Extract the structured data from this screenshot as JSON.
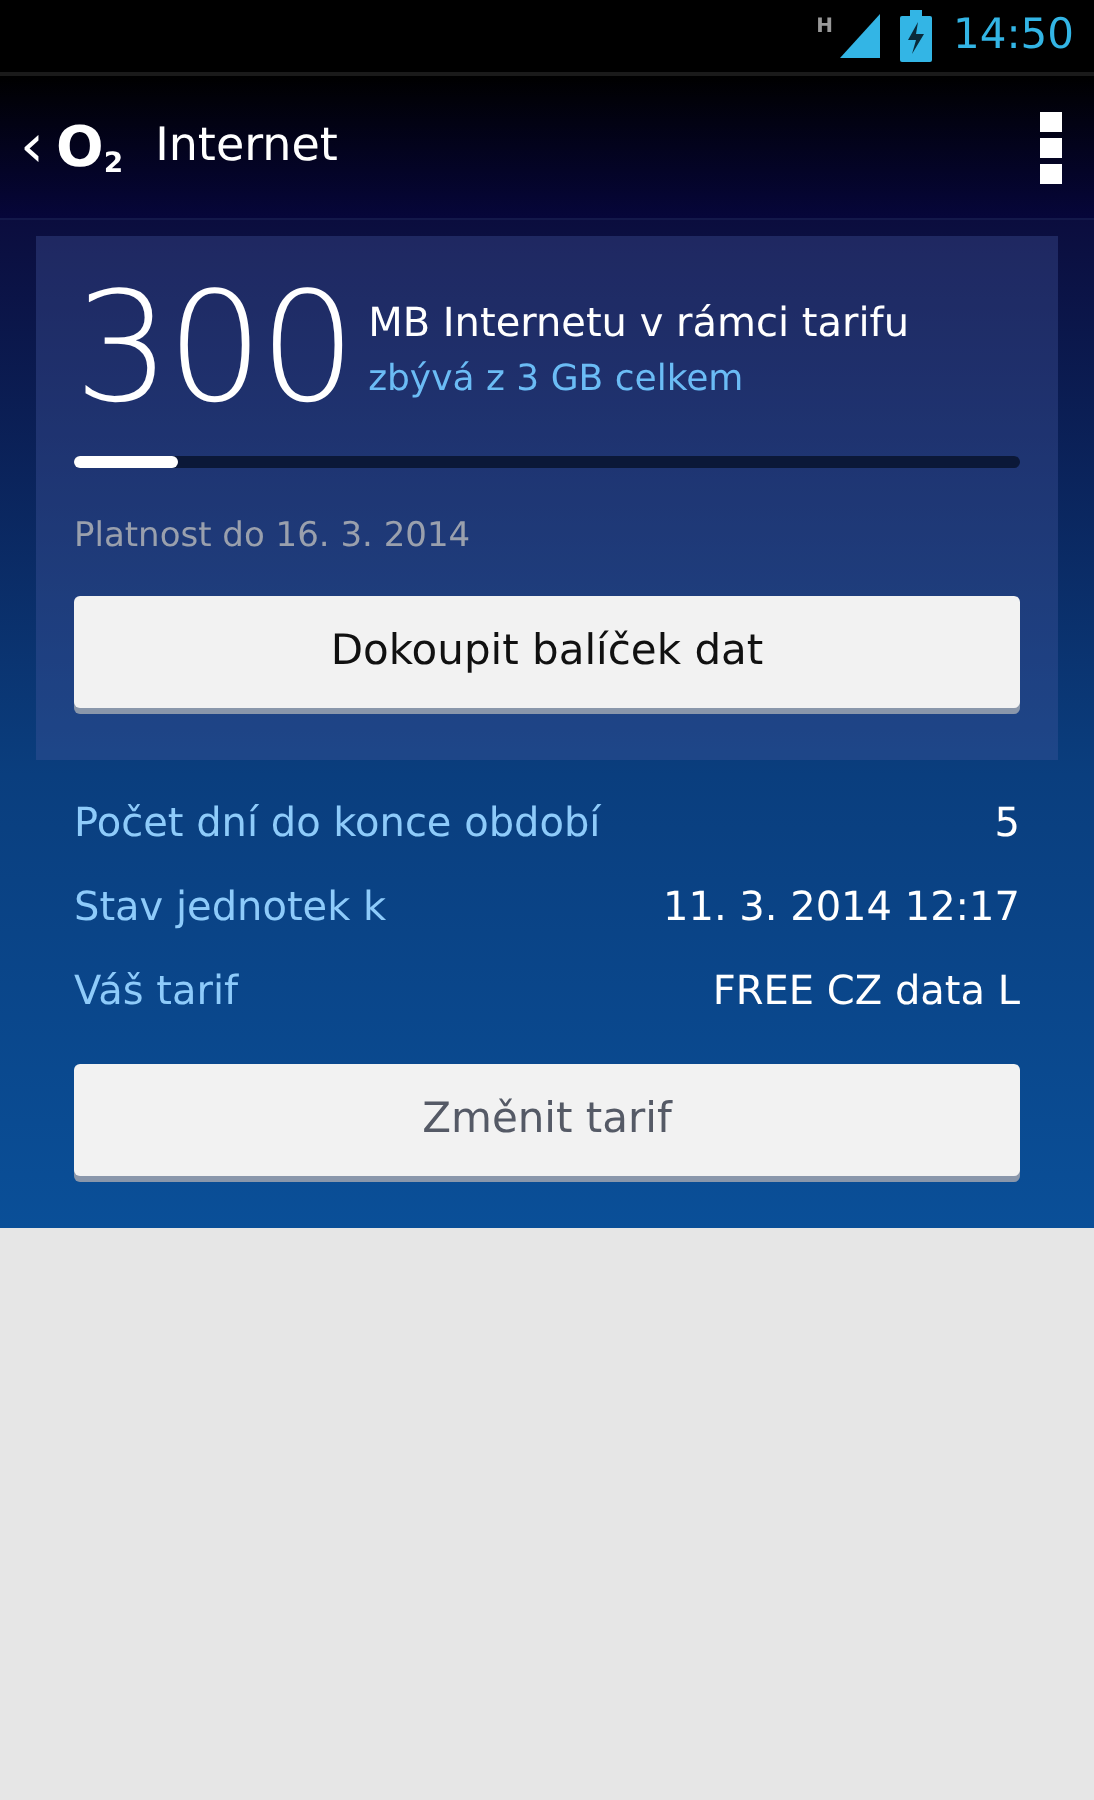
{
  "status_bar": {
    "network_type": "H",
    "time": "14:50"
  },
  "app_bar": {
    "back": "‹",
    "logo": "O$_{2}$",
    "title": "Internet"
  },
  "quota": {
    "amount": "300",
    "unit_line": "MB Internetu v rámci tarifu",
    "remaining_line": "zbývá z 3 GB celkem",
    "level": 0.11,
    "validity": "Platnost do 16. 3. 2014",
    "button": {
      "label": "Dokoupit balíček dat",
      "disabled": false
    }
  },
  "details": [
    {
      "label": "Počet dní do konce období",
      "value": "5"
    },
    {
      "label": "Stav jednotek k",
      "value": "11. 3. 2014 12:17"
    },
    {
      "label": "Váš tarif",
      "value": "FREE CZ data L"
    }
  ],
  "change_button": {
    "label": "Změnit tarif",
    "disabled": true
  }
}
